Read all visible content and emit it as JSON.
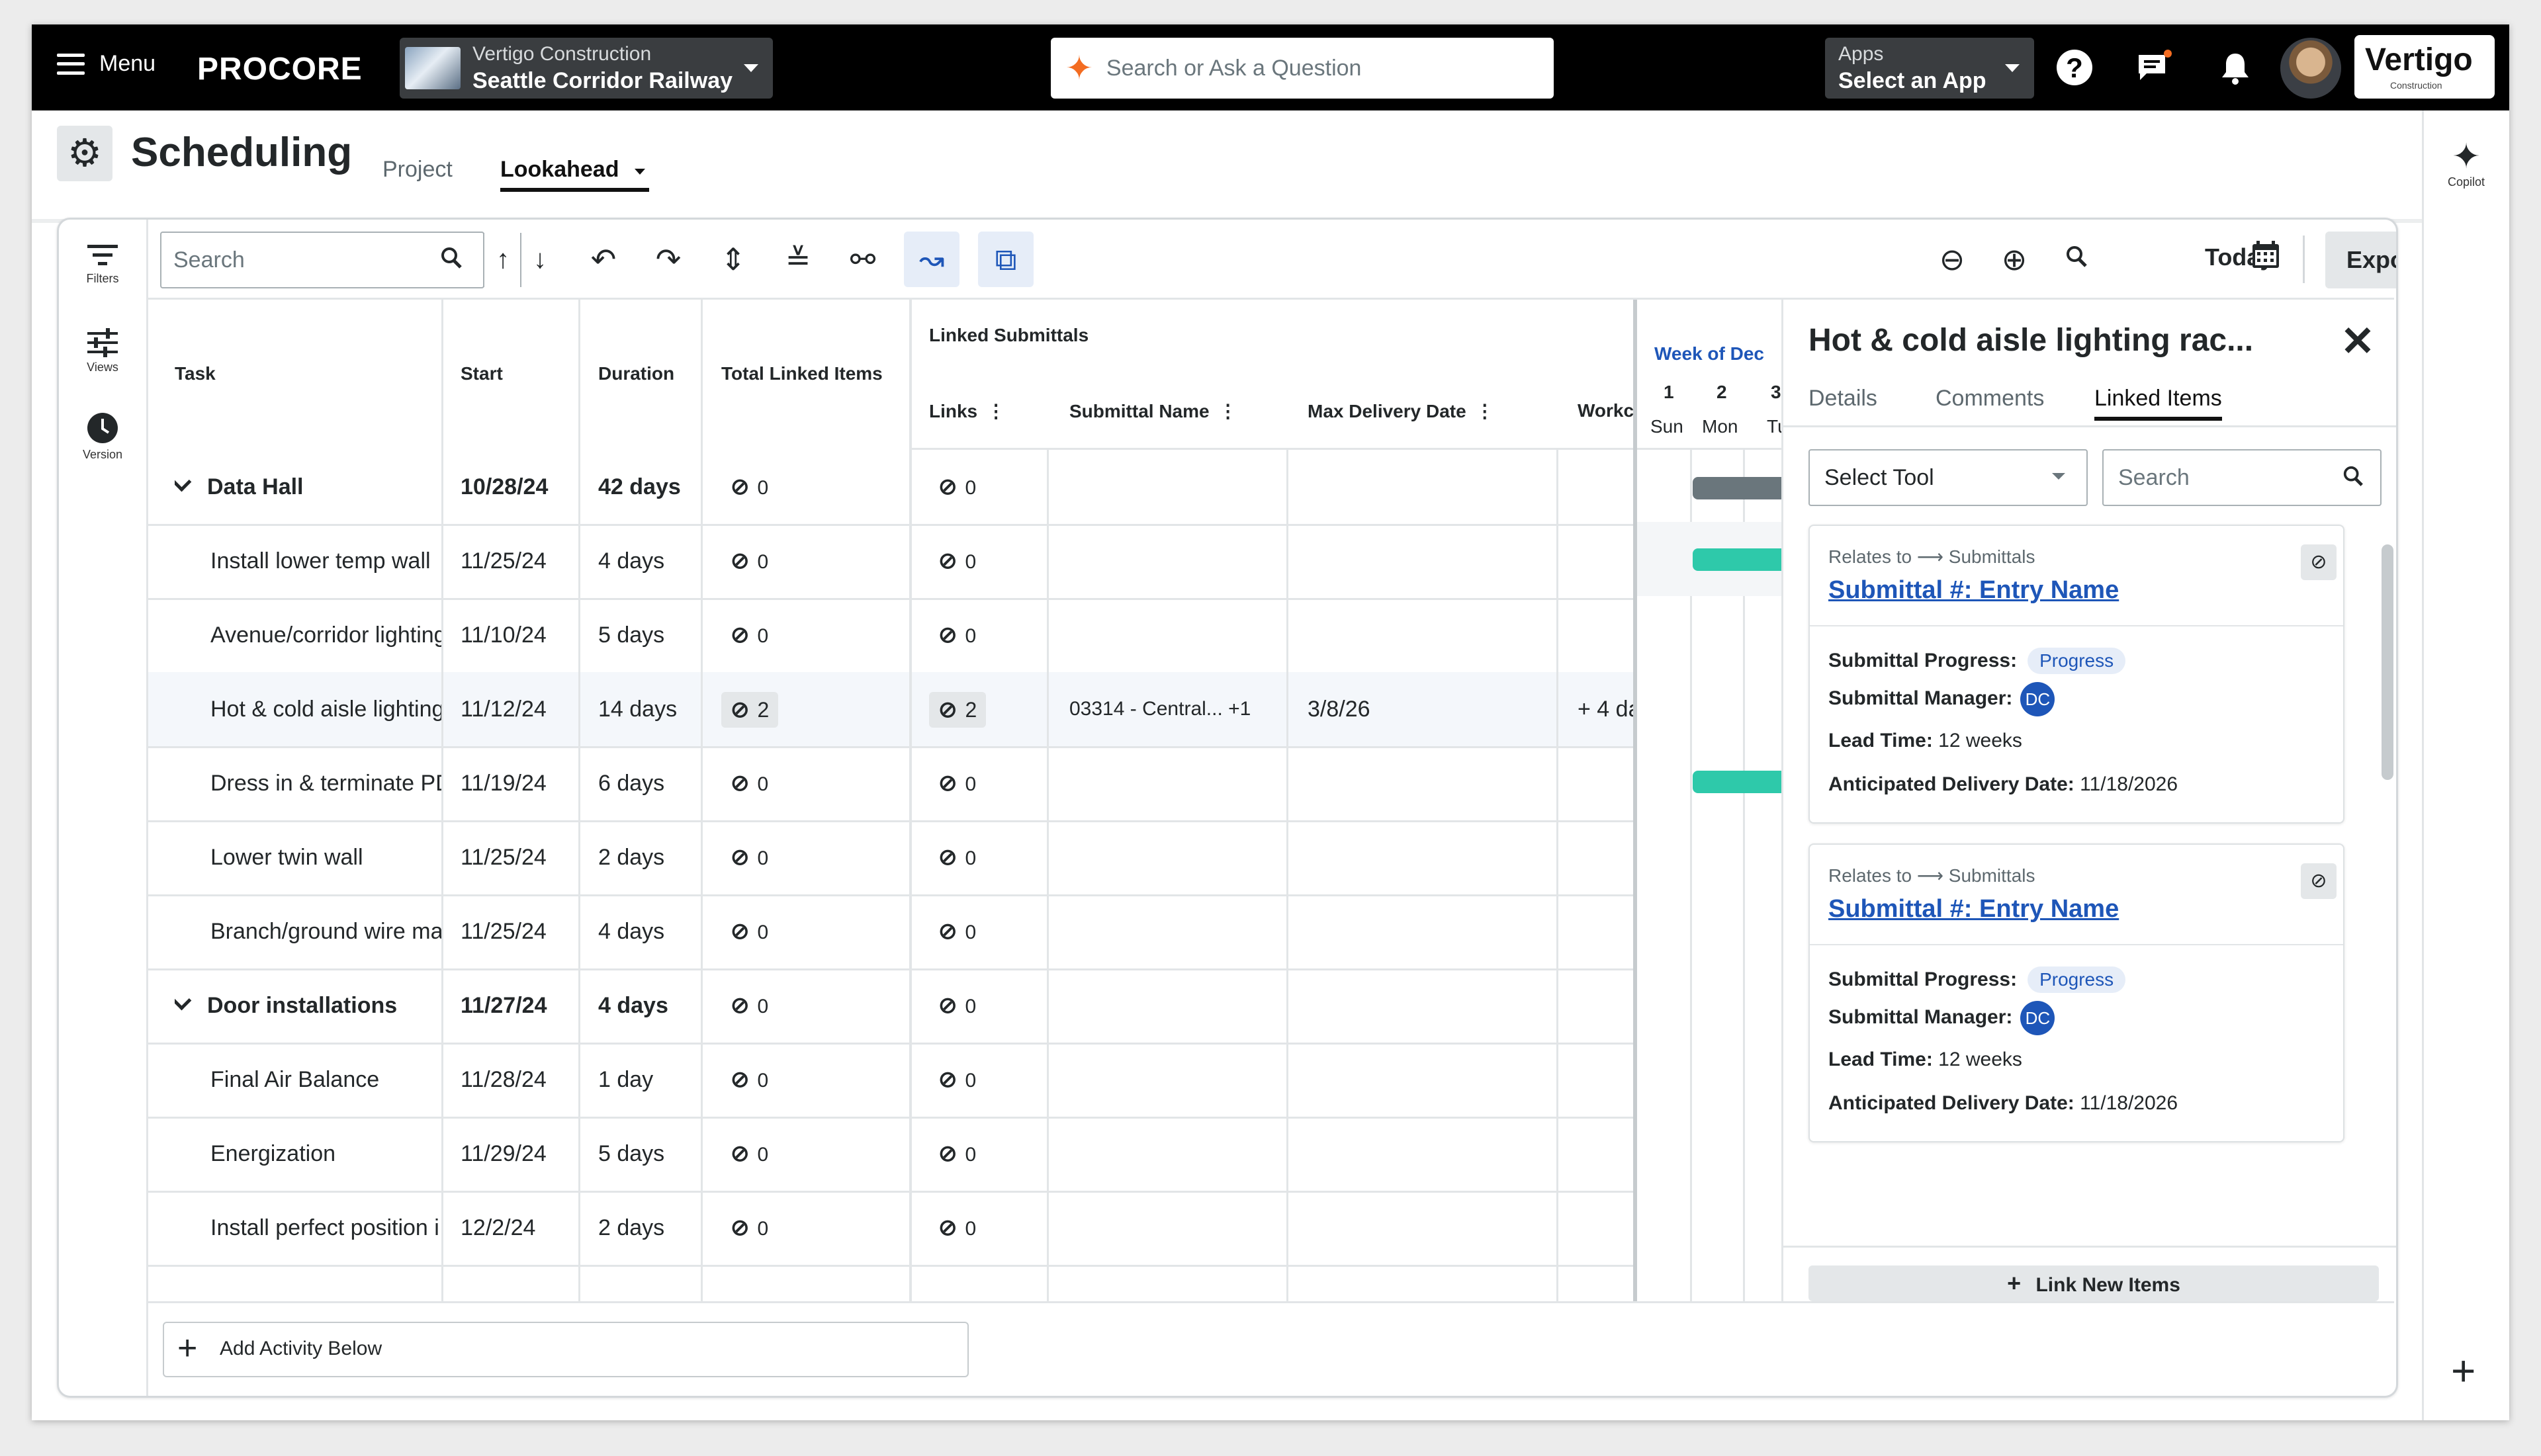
{
  "topnav": {
    "menu_label": "Menu",
    "logo": "PROCORE",
    "project_company": "Vertigo Construction",
    "project_name": "Seattle Corridor Railway",
    "search_placeholder": "Search or Ask a Question",
    "apps_label": "Apps",
    "apps_value": "Select an App",
    "help_label": "?",
    "company_logo": "Vertigo",
    "company_logo_sub": "Construction"
  },
  "header": {
    "title": "Scheduling",
    "tabs": [
      {
        "label": "Project",
        "active": false
      },
      {
        "label": "Lookahead",
        "active": true
      }
    ]
  },
  "rail": {
    "copilot_label": "Copilot"
  },
  "leftnav": [
    {
      "label": "Filters",
      "icon": "filter-icon"
    },
    {
      "label": "Views",
      "icon": "sliders-icon"
    },
    {
      "label": "Version",
      "icon": "clock-icon"
    }
  ],
  "toolbar": {
    "search_placeholder": "Search",
    "today_label": "Today",
    "export_label": "Export"
  },
  "table": {
    "headers": {
      "task": "Task",
      "start": "Start",
      "duration": "Duration",
      "total_linked": "Total Linked Items",
      "group": "Linked Submittals",
      "links": "Links",
      "submittal_name": "Submittal Name",
      "max_delivery": "Max Delivery Date",
      "work": "Workc"
    },
    "rows": [
      {
        "task": "Data Hall",
        "start": "10/28/24",
        "duration": "42 days",
        "total": "0",
        "links": "0",
        "name": "",
        "delivery": "",
        "work": "",
        "group": true
      },
      {
        "task": "Install lower temp wall",
        "start": "11/25/24",
        "duration": "4 days",
        "total": "0",
        "links": "0",
        "name": "",
        "delivery": "",
        "work": ""
      },
      {
        "task": "Avenue/corridor lighting",
        "start": "11/10/24",
        "duration": "5 days",
        "total": "0",
        "links": "0",
        "name": "",
        "delivery": "",
        "work": ""
      },
      {
        "task": "Hot & cold aisle lighting",
        "start": "11/12/24",
        "duration": "14 days",
        "total": "2",
        "links": "2",
        "name": "03314 - Central... +1",
        "delivery": "3/8/26",
        "work": "+ 4 da",
        "selected": true
      },
      {
        "task": "Dress in & terminate PD",
        "start": "11/19/24",
        "duration": "6 days",
        "total": "0",
        "links": "0",
        "name": "",
        "delivery": "",
        "work": ""
      },
      {
        "task": "Lower twin wall",
        "start": "11/25/24",
        "duration": "2 days",
        "total": "0",
        "links": "0",
        "name": "",
        "delivery": "",
        "work": ""
      },
      {
        "task": "Branch/ground wire ma",
        "start": "11/25/24",
        "duration": "4 days",
        "total": "0",
        "links": "0",
        "name": "",
        "delivery": "",
        "work": ""
      },
      {
        "task": "Door installations",
        "start": "11/27/24",
        "duration": "4 days",
        "total": "0",
        "links": "0",
        "name": "",
        "delivery": "",
        "work": "",
        "group": true
      },
      {
        "task": "Final Air Balance",
        "start": "11/28/24",
        "duration": "1 day",
        "total": "0",
        "links": "0",
        "name": "",
        "delivery": "",
        "work": ""
      },
      {
        "task": "Energization",
        "start": "11/29/24",
        "duration": "5 days",
        "total": "0",
        "links": "0",
        "name": "",
        "delivery": "",
        "work": ""
      },
      {
        "task": "Install perfect position i",
        "start": "12/2/24",
        "duration": "2 days",
        "total": "0",
        "links": "0",
        "name": "",
        "delivery": "",
        "work": ""
      }
    ]
  },
  "gantt": {
    "week_label": "Week of Dec",
    "days": [
      {
        "num": "1",
        "name": "Sun"
      },
      {
        "num": "2",
        "name": "Mon"
      },
      {
        "num": "3",
        "name": "Tu"
      }
    ]
  },
  "panel": {
    "title": "Hot & cold aisle lighting rac...",
    "tabs": [
      {
        "label": "Details",
        "active": false
      },
      {
        "label": "Comments",
        "active": false
      },
      {
        "label": "Linked Items",
        "active": true
      }
    ],
    "select_tool": "Select Tool",
    "search_placeholder": "Search",
    "cards": [
      {
        "relates_to": "Relates to",
        "relates_target": "Submittals",
        "title": "Submittal #: Entry Name",
        "progress_label": "Submittal Progress:",
        "progress_value": "Progress",
        "manager_label": "Submittal Manager:",
        "manager_initials": "DC",
        "lead_label": "Lead Time:",
        "lead_value": "12 weeks",
        "delivery_label": "Anticipated Delivery Date:",
        "delivery_value": "11/18/2026"
      },
      {
        "relates_to": "Relates to",
        "relates_target": "Submittals",
        "title": "Submittal #: Entry Name",
        "progress_label": "Submittal Progress:",
        "progress_value": "Progress",
        "manager_label": "Submittal Manager:",
        "manager_initials": "DC",
        "lead_label": "Lead Time:",
        "lead_value": "12 weeks",
        "delivery_label": "Anticipated Delivery Date:",
        "delivery_value": "11/18/2026"
      }
    ],
    "link_new": "Link New Items"
  },
  "footer": {
    "add_activity": "Add Activity Below"
  },
  "colors": {
    "accent": "#1e56b8",
    "brand_orange": "#f36c21",
    "gantt_teal": "#2ec9aa",
    "gantt_gray": "#6a767c"
  }
}
